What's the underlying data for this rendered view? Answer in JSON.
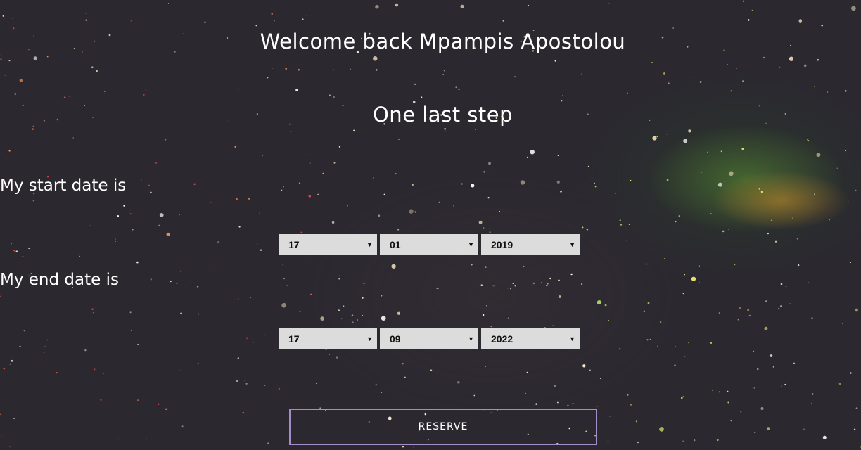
{
  "header": {
    "welcome": "Welcome back Mpampis Apostolou",
    "step": "One last step"
  },
  "start_date": {
    "label": "My start date is",
    "day": "17",
    "month": "01",
    "year": "2019"
  },
  "end_date": {
    "label": "My end date is",
    "day": "17",
    "month": "09",
    "year": "2022"
  },
  "actions": {
    "reserve_label": "RESERVE"
  },
  "colors": {
    "background": "#2b2830",
    "select_bg": "#dcdcdc",
    "button_border": "#a58ec8",
    "nebula_green": "#5a8c32",
    "nebula_orange": "#cd8c28"
  },
  "icons": {
    "dropdown": "triangle-down-icon"
  }
}
